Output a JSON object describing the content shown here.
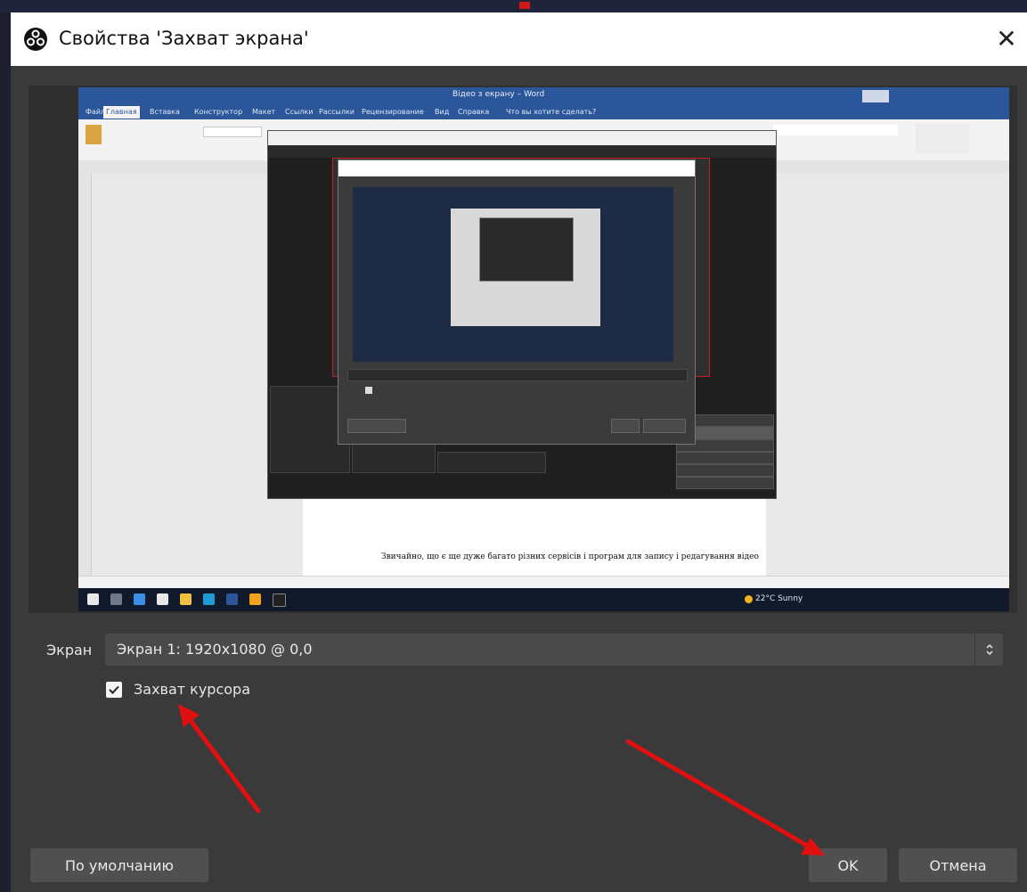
{
  "dialog": {
    "title": "Свойства 'Захват экрана'",
    "close_label": "✕"
  },
  "preview": {
    "word_title": "Відео з екрану – Word",
    "word_menu": [
      "Файл",
      "Главная",
      "Вставка",
      "Конструктор",
      "Макет",
      "Ссылки",
      "Рассылки",
      "Рецензирование",
      "Вид",
      "Справка",
      "Что вы хотите сделать?"
    ],
    "document_text": "Звичайно, що є ще дуже багато різних сервісів і програм для запису і редагування відео",
    "weather": "22°C Sunny"
  },
  "screen_select": {
    "label": "Экран",
    "value": "Экран 1: 1920x1080 @ 0,0"
  },
  "capture_cursor": {
    "label": "Захват курсора",
    "checked": true
  },
  "buttons": {
    "defaults": "По умолчанию",
    "ok": "OK",
    "cancel": "Отмена"
  },
  "colors": {
    "annotation_arrows": "#e01010",
    "dialog_bg": "#3a3a3a",
    "button_bg": "#505050",
    "word_blue": "#2b579a"
  }
}
